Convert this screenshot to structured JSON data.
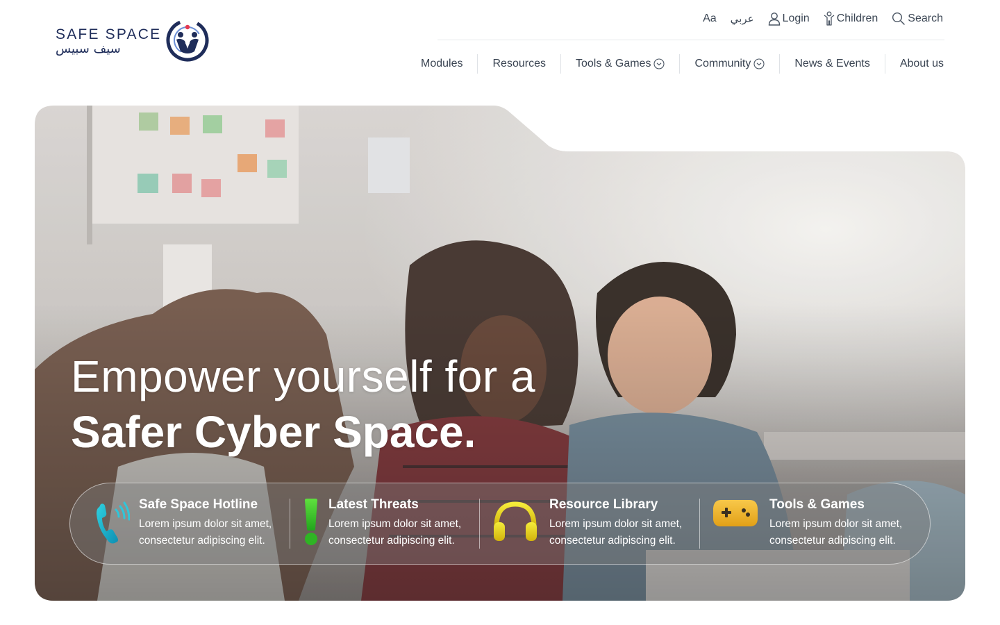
{
  "brand": {
    "name_en": "SAFE SPACE",
    "name_ar": "سيف سبيس"
  },
  "utility_nav": {
    "font_size_label": "Aa",
    "language_label": "عربي",
    "login_label": "Login",
    "children_label": "Children",
    "search_label": "Search"
  },
  "main_nav": {
    "items": [
      {
        "label": "Modules",
        "has_dropdown": false
      },
      {
        "label": "Resources",
        "has_dropdown": false
      },
      {
        "label": "Tools & Games",
        "has_dropdown": true
      },
      {
        "label": "Community",
        "has_dropdown": true
      },
      {
        "label": "News & Events",
        "has_dropdown": false
      },
      {
        "label": "About us",
        "has_dropdown": false
      }
    ]
  },
  "hero": {
    "headline_line1": "Empower yourself for a",
    "headline_line2": "Safer Cyber Space."
  },
  "quick_links": [
    {
      "title": "Safe Space Hotline",
      "desc_line1": "Lorem ipsum dolor sit amet,",
      "desc_line2": "consectetur adipiscing elit.",
      "icon": "phone-icon",
      "color": "#17b3c9"
    },
    {
      "title": "Latest Threats",
      "desc_line1": "Lorem ipsum dolor sit amet,",
      "desc_line2": "consectetur adipiscing elit.",
      "icon": "exclamation-icon",
      "color": "#3fc42a"
    },
    {
      "title": "Resource Library",
      "desc_line1": "Lorem ipsum dolor sit amet,",
      "desc_line2": "consectetur adipiscing elit.",
      "icon": "headphones-icon",
      "color": "#e8cf16"
    },
    {
      "title": "Tools & Games",
      "desc_line1": "Lorem ipsum dolor sit amet,",
      "desc_line2": "consectetur adipiscing elit.",
      "icon": "gamepad-icon",
      "color": "#f0b429"
    }
  ],
  "colors": {
    "brand_navy": "#1f2d5a",
    "nav_text": "#3a4452",
    "hotline": "#17b3c9",
    "threats": "#3fc42a",
    "library": "#e8cf16",
    "games": "#f0b429"
  }
}
